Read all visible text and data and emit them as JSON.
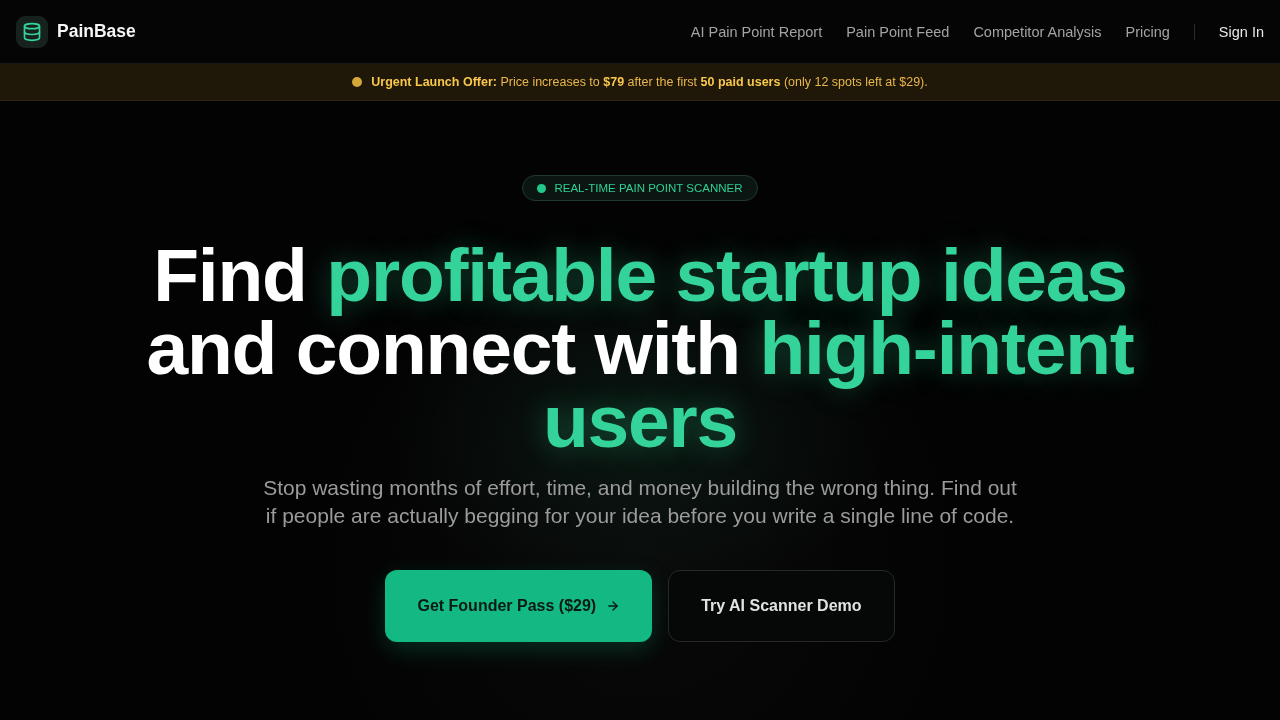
{
  "header": {
    "brand": "PainBase",
    "nav_links": [
      "AI Pain Point Report",
      "Pain Point Feed",
      "Competitor Analysis",
      "Pricing"
    ],
    "sign_in": "Sign In"
  },
  "announcement": {
    "text": "**Urgent Launch Offer:** Price increases to **$79** after the first **50 paid users** (only 12 spots left at $29)."
  },
  "hero": {
    "badge": "REAL-TIME PAIN POINT SCANNER",
    "headline": [
      {
        "text": "Find ",
        "highlight": false
      },
      {
        "text": "profitable startup ideas",
        "highlight": true
      },
      {
        "text": " and connect with ",
        "highlight": false
      },
      {
        "text": "high-intent users",
        "highlight": true
      }
    ],
    "subtitle": "Stop wasting months of effort, time, and money building the wrong thing. Find out if people are actually begging for your idea before you write a single line of code.",
    "buttons": [
      {
        "label": "Get Founder Pass ($29)",
        "kind": "primary"
      },
      {
        "label": "Try AI Scanner Demo",
        "kind": "secondary"
      }
    ]
  }
}
